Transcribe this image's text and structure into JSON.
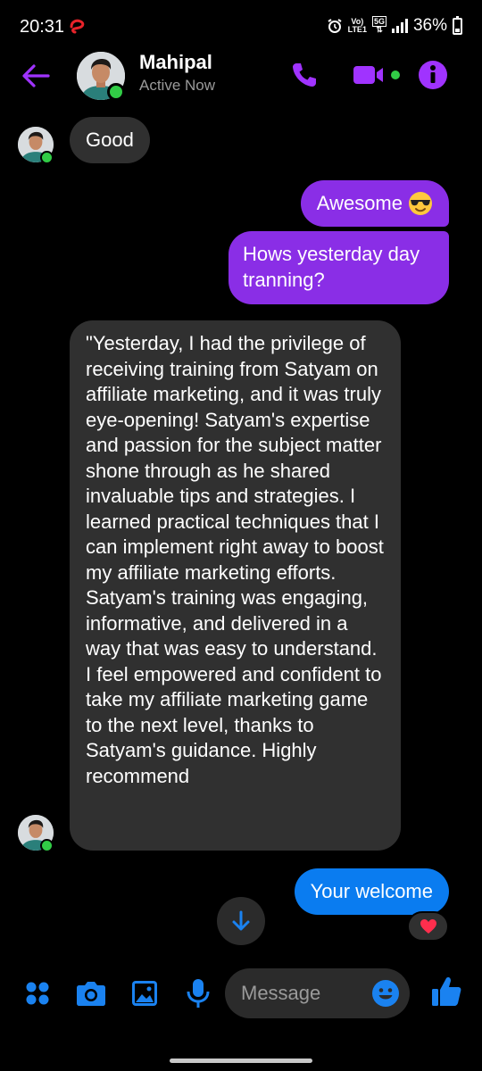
{
  "status_bar": {
    "time": "20:31",
    "network_top": "Vo)",
    "network_bottom": "LTE1",
    "gen_top": "5G",
    "battery": "36%"
  },
  "header": {
    "contact_name": "Mahipal",
    "contact_status": "Active Now"
  },
  "messages": [
    {
      "direction": "in",
      "text": "Good"
    },
    {
      "direction": "out",
      "text": "Awesome"
    },
    {
      "direction": "out",
      "text": "Hows yesterday day tranning?"
    },
    {
      "direction": "in",
      "text": "\"Yesterday, I had the privilege of receiving training from Satyam on affiliate marketing, and it was truly eye-opening! Satyam's expertise and passion for the subject matter shone through as he shared invaluable tips and strategies. I learned practical techniques that I can implement right away to boost my affiliate marketing efforts. Satyam's training was engaging, informative, and delivered in a way that was easy to understand. I feel empowered and confident to take my affiliate marketing game to the next level, thanks to Satyam's guidance. Highly recommend"
    },
    {
      "direction": "out",
      "text": "Your welcome",
      "reaction": "heart"
    }
  ],
  "composer": {
    "placeholder": "Message"
  },
  "colors": {
    "accent_purple": "#a033ff",
    "outgoing_bubble": "#8a2ee6",
    "incoming_bubble": "#303030",
    "blue_bubble": "#0a7cf0",
    "online_green": "#31cc46",
    "composer_blue": "#1a82f0"
  },
  "icons": {
    "header": [
      "back-arrow-icon",
      "phone-icon",
      "video-camera-icon",
      "info-icon"
    ],
    "composer": [
      "apps-icon",
      "camera-icon",
      "gallery-icon",
      "microphone-icon",
      "emoji-icon",
      "thumbs-up-icon"
    ]
  }
}
